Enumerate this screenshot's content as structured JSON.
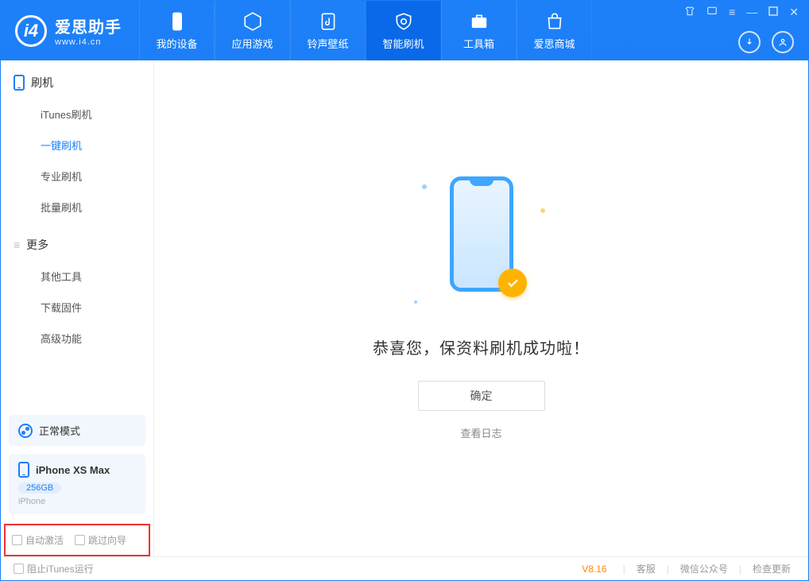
{
  "app": {
    "title": "爱思助手",
    "subtitle": "www.i4.cn"
  },
  "nav": {
    "items": [
      {
        "label": "我的设备"
      },
      {
        "label": "应用游戏"
      },
      {
        "label": "铃声壁纸"
      },
      {
        "label": "智能刷机"
      },
      {
        "label": "工具箱"
      },
      {
        "label": "爱思商城"
      }
    ]
  },
  "sidebar": {
    "section1_title": "刷机",
    "items1": [
      {
        "label": "iTunes刷机"
      },
      {
        "label": "一键刷机"
      },
      {
        "label": "专业刷机"
      },
      {
        "label": "批量刷机"
      }
    ],
    "section2_title": "更多",
    "items2": [
      {
        "label": "其他工具"
      },
      {
        "label": "下载固件"
      },
      {
        "label": "高级功能"
      }
    ],
    "mode_label": "正常模式",
    "device_name": "iPhone XS Max",
    "device_storage": "256GB",
    "device_type": "iPhone",
    "checkbox_auto_activate": "自动激活",
    "checkbox_skip_guide": "跳过向导"
  },
  "main": {
    "success_text": "恭喜您，保资料刷机成功啦！",
    "ok_button": "确定",
    "view_log": "查看日志"
  },
  "footer": {
    "block_itunes": "阻止iTunes运行",
    "version": "V8.16",
    "links": [
      "客服",
      "微信公众号",
      "检查更新"
    ]
  }
}
